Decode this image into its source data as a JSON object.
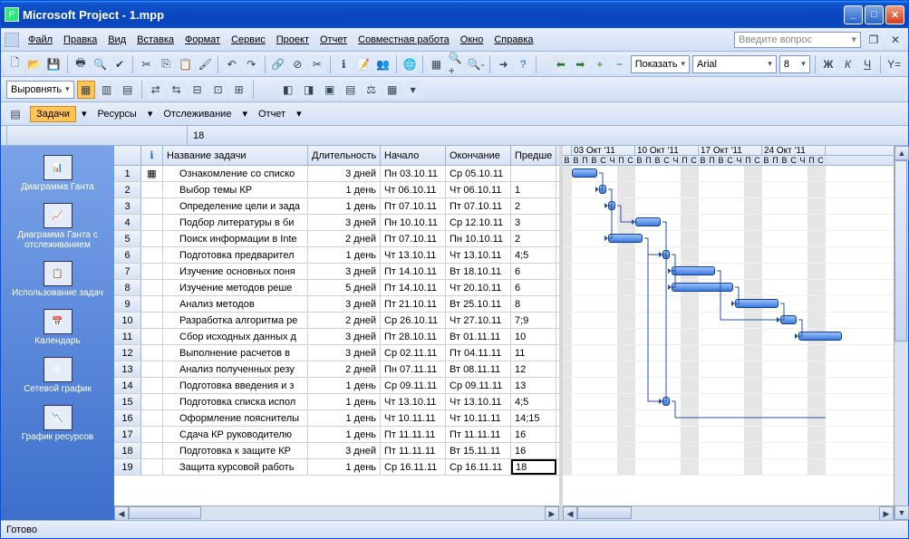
{
  "window": {
    "title": "Microsoft Project - 1.mpp"
  },
  "menu": {
    "items": [
      "Файл",
      "Правка",
      "Вид",
      "Вставка",
      "Формат",
      "Сервис",
      "Проект",
      "Отчет",
      "Совместная работа",
      "Окно",
      "Справка"
    ],
    "help_box": "Введите вопрос"
  },
  "toolbar2": {
    "show_label": "Показать",
    "font": "Arial",
    "size": "8"
  },
  "toolbar3": {
    "align_label": "Выровнять"
  },
  "viewbar": {
    "tasks": "Задачи",
    "resources": "Ресурсы",
    "tracking": "Отслеживание",
    "report": "Отчет"
  },
  "formula": {
    "value": "18"
  },
  "sidebar": {
    "items": [
      {
        "label": "Диаграмма Ганта"
      },
      {
        "label": "Диаграмма Ганта с отслеживанием"
      },
      {
        "label": "Использование задач"
      },
      {
        "label": "Календарь"
      },
      {
        "label": "Сетевой график"
      },
      {
        "label": "График ресурсов"
      }
    ]
  },
  "columns": {
    "info": "",
    "name": "Название задачи",
    "duration": "Длительность",
    "start": "Начало",
    "finish": "Окончание",
    "pred": "Предше"
  },
  "rows": [
    {
      "n": 1,
      "name": "Ознакомление со списко",
      "dur": "3 дней",
      "start": "Пн 03.10.11",
      "finish": "Ср 05.10.11",
      "pred": ""
    },
    {
      "n": 2,
      "name": "Выбор темы КР",
      "dur": "1 день",
      "start": "Чт 06.10.11",
      "finish": "Чт 06.10.11",
      "pred": "1"
    },
    {
      "n": 3,
      "name": "Определение цели и зада",
      "dur": "1 день",
      "start": "Пт 07.10.11",
      "finish": "Пт 07.10.11",
      "pred": "2"
    },
    {
      "n": 4,
      "name": "Подбор литературы в би",
      "dur": "3 дней",
      "start": "Пн 10.10.11",
      "finish": "Ср 12.10.11",
      "pred": "3"
    },
    {
      "n": 5,
      "name": "Поиск информации в Inte",
      "dur": "2 дней",
      "start": "Пт 07.10.11",
      "finish": "Пн 10.10.11",
      "pred": "2"
    },
    {
      "n": 6,
      "name": "Подготовка предварител",
      "dur": "1 день",
      "start": "Чт 13.10.11",
      "finish": "Чт 13.10.11",
      "pred": "4;5"
    },
    {
      "n": 7,
      "name": "Изучение основных поня",
      "dur": "3 дней",
      "start": "Пт 14.10.11",
      "finish": "Вт 18.10.11",
      "pred": "6"
    },
    {
      "n": 8,
      "name": "Изучение методов реше",
      "dur": "5 дней",
      "start": "Пт 14.10.11",
      "finish": "Чт 20.10.11",
      "pred": "6"
    },
    {
      "n": 9,
      "name": "Анализ методов",
      "dur": "3 дней",
      "start": "Пт 21.10.11",
      "finish": "Вт 25.10.11",
      "pred": "8"
    },
    {
      "n": 10,
      "name": "Разработка алгоритма ре",
      "dur": "2 дней",
      "start": "Ср 26.10.11",
      "finish": "Чт 27.10.11",
      "pred": "7;9"
    },
    {
      "n": 11,
      "name": "Сбор исходных данных д",
      "dur": "3 дней",
      "start": "Пт 28.10.11",
      "finish": "Вт 01.11.11",
      "pred": "10"
    },
    {
      "n": 12,
      "name": "Выполнение расчетов в",
      "dur": "3 дней",
      "start": "Ср 02.11.11",
      "finish": "Пт 04.11.11",
      "pred": "11"
    },
    {
      "n": 13,
      "name": "Анализ полученных резу",
      "dur": "2 дней",
      "start": "Пн 07.11.11",
      "finish": "Вт 08.11.11",
      "pred": "12"
    },
    {
      "n": 14,
      "name": "Подготовка введения и з",
      "dur": "1 день",
      "start": "Ср 09.11.11",
      "finish": "Ср 09.11.11",
      "pred": "13"
    },
    {
      "n": 15,
      "name": "Подготовка списка испол",
      "dur": "1 день",
      "start": "Чт 13.10.11",
      "finish": "Чт 13.10.11",
      "pred": "4;5"
    },
    {
      "n": 16,
      "name": "Оформление пояснителы",
      "dur": "1 день",
      "start": "Чт 10.11.11",
      "finish": "Чт 10.11.11",
      "pred": "14;15"
    },
    {
      "n": 17,
      "name": "Сдача КР руководителю",
      "dur": "1 день",
      "start": "Пт 11.11.11",
      "finish": "Пт 11.11.11",
      "pred": "16"
    },
    {
      "n": 18,
      "name": "Подготовка к защите КР",
      "dur": "3 дней",
      "start": "Пт 11.11.11",
      "finish": "Вт 15.11.11",
      "pred": "16"
    },
    {
      "n": 19,
      "name": "Защита курсовой работь",
      "dur": "1 день",
      "start": "Ср 16.11.11",
      "finish": "Ср 16.11.11",
      "pred": "18"
    }
  ],
  "timeline": {
    "weeks": [
      "03 Окт '11",
      "10 Окт '11",
      "17 Окт '11",
      "24 Окт '11"
    ],
    "days": [
      "В",
      "П",
      "В",
      "С",
      "Ч",
      "П",
      "С"
    ]
  },
  "status": "Готово",
  "chart_data": {
    "type": "gantt",
    "title": "Диаграмма Ганта",
    "x_unit": "days",
    "start_date": "2011-10-02",
    "timescale_days_visible": 28,
    "tasks": [
      {
        "id": 1,
        "name": "Ознакомление со списком",
        "start": "2011-10-03",
        "finish": "2011-10-05",
        "duration_days": 3,
        "predecessors": []
      },
      {
        "id": 2,
        "name": "Выбор темы КР",
        "start": "2011-10-06",
        "finish": "2011-10-06",
        "duration_days": 1,
        "predecessors": [
          1
        ]
      },
      {
        "id": 3,
        "name": "Определение цели и задач",
        "start": "2011-10-07",
        "finish": "2011-10-07",
        "duration_days": 1,
        "predecessors": [
          2
        ]
      },
      {
        "id": 4,
        "name": "Подбор литературы в библиотеке",
        "start": "2011-10-10",
        "finish": "2011-10-12",
        "duration_days": 3,
        "predecessors": [
          3
        ]
      },
      {
        "id": 5,
        "name": "Поиск информации в Internet",
        "start": "2011-10-07",
        "finish": "2011-10-10",
        "duration_days": 2,
        "predecessors": [
          2
        ]
      },
      {
        "id": 6,
        "name": "Подготовка предварительного",
        "start": "2011-10-13",
        "finish": "2011-10-13",
        "duration_days": 1,
        "predecessors": [
          4,
          5
        ]
      },
      {
        "id": 7,
        "name": "Изучение основных понятий",
        "start": "2011-10-14",
        "finish": "2011-10-18",
        "duration_days": 3,
        "predecessors": [
          6
        ]
      },
      {
        "id": 8,
        "name": "Изучение методов решения",
        "start": "2011-10-14",
        "finish": "2011-10-20",
        "duration_days": 5,
        "predecessors": [
          6
        ]
      },
      {
        "id": 9,
        "name": "Анализ методов",
        "start": "2011-10-21",
        "finish": "2011-10-25",
        "duration_days": 3,
        "predecessors": [
          8
        ]
      },
      {
        "id": 10,
        "name": "Разработка алгоритма",
        "start": "2011-10-26",
        "finish": "2011-10-27",
        "duration_days": 2,
        "predecessors": [
          7,
          9
        ]
      },
      {
        "id": 11,
        "name": "Сбор исходных данных",
        "start": "2011-10-28",
        "finish": "2011-11-01",
        "duration_days": 3,
        "predecessors": [
          10
        ]
      },
      {
        "id": 12,
        "name": "Выполнение расчетов",
        "start": "2011-11-02",
        "finish": "2011-11-04",
        "duration_days": 3,
        "predecessors": [
          11
        ]
      },
      {
        "id": 13,
        "name": "Анализ полученных результатов",
        "start": "2011-11-07",
        "finish": "2011-11-08",
        "duration_days": 2,
        "predecessors": [
          12
        ]
      },
      {
        "id": 14,
        "name": "Подготовка введения",
        "start": "2011-11-09",
        "finish": "2011-11-09",
        "duration_days": 1,
        "predecessors": [
          13
        ]
      },
      {
        "id": 15,
        "name": "Подготовка списка использованной",
        "start": "2011-10-13",
        "finish": "2011-10-13",
        "duration_days": 1,
        "predecessors": [
          4,
          5
        ]
      },
      {
        "id": 16,
        "name": "Оформление пояснительной",
        "start": "2011-11-10",
        "finish": "2011-11-10",
        "duration_days": 1,
        "predecessors": [
          14,
          15
        ]
      },
      {
        "id": 17,
        "name": "Сдача КР руководителю",
        "start": "2011-11-11",
        "finish": "2011-11-11",
        "duration_days": 1,
        "predecessors": [
          16
        ]
      },
      {
        "id": 18,
        "name": "Подготовка к защите КР",
        "start": "2011-11-11",
        "finish": "2011-11-15",
        "duration_days": 3,
        "predecessors": [
          16
        ]
      },
      {
        "id": 19,
        "name": "Защита курсовой работы",
        "start": "2011-11-16",
        "finish": "2011-11-16",
        "duration_days": 1,
        "predecessors": [
          18
        ]
      }
    ]
  }
}
